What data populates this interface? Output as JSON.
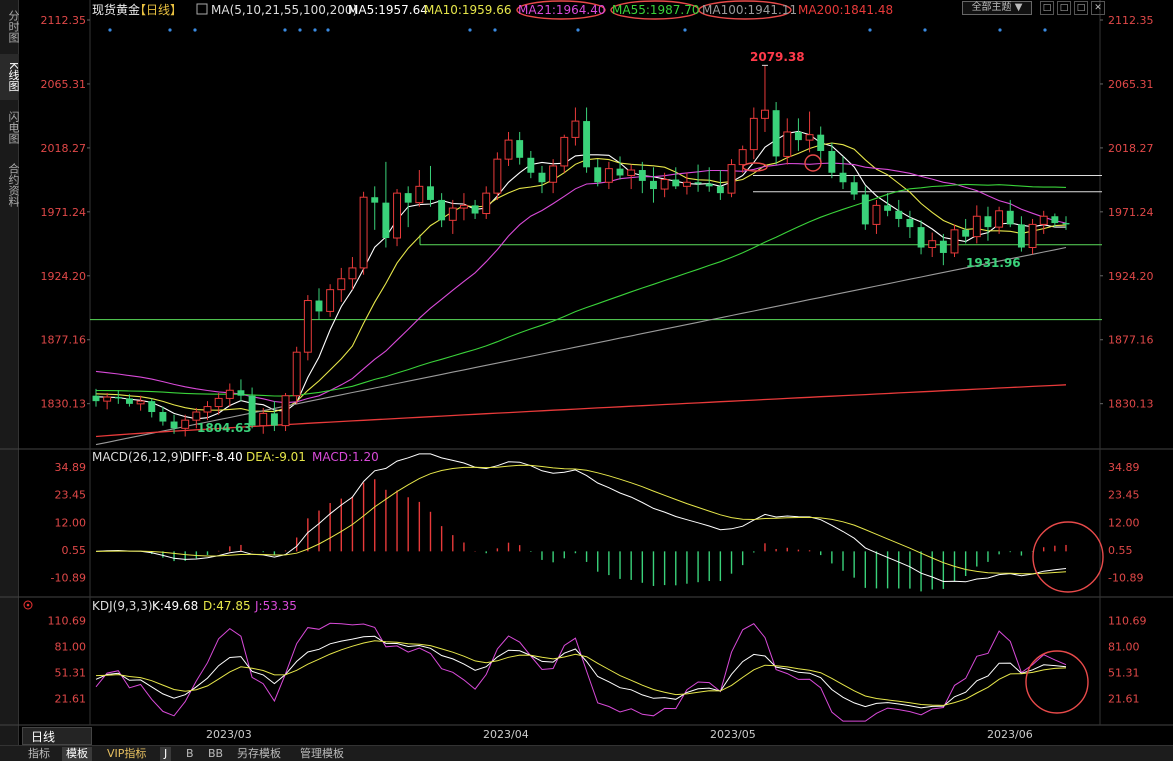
{
  "sidebar": {
    "tabs": [
      "分时图",
      "K线图",
      "闪电图",
      "合约资料"
    ],
    "active_index": 1
  },
  "header": {
    "instrument": "现货黄金",
    "period": "【日线】",
    "ma_label": "MA(5,10,21,55,100,200)",
    "ma_values": [
      {
        "text": "MA5:1957.64",
        "color": "#ffffff"
      },
      {
        "text": "MA10:1959.66",
        "color": "#e6e64a"
      },
      {
        "text": "MA21:1964.40",
        "color": "#d84ad8"
      },
      {
        "text": "MA55:1987.70",
        "color": "#3ad23a"
      },
      {
        "text": "MA100:1941.11",
        "color": "#9a9a9a"
      },
      {
        "text": "MA200:1841.48",
        "color": "#e83a3a"
      }
    ],
    "theme_button": "全部主题",
    "window_buttons": [
      "□",
      "□",
      "□",
      "✕"
    ]
  },
  "price_axis": {
    "ticks": [
      "2112.35",
      "2065.31",
      "2018.27",
      "1971.24",
      "1924.20",
      "1877.16",
      "1830.13"
    ],
    "range": [
      1799.0,
      2112.35
    ]
  },
  "annotations": {
    "high": "2079.38",
    "low": "1804.63",
    "mid_low": "1931.96"
  },
  "macd": {
    "label": "MACD(26,12,9)",
    "diff": "DIFF:-8.40",
    "dea": "DEA:-9.01",
    "macd": "MACD:1.20",
    "ticks": [
      "34.89",
      "23.45",
      "12.00",
      "0.55",
      "-10.89"
    ],
    "range": [
      -16,
      37
    ]
  },
  "kdj": {
    "label": "KDJ(9,3,3)",
    "k": "K:49.68",
    "d": "D:47.85",
    "j": "J:53.35",
    "ticks": [
      "110.69",
      "81.00",
      "51.31",
      "21.61"
    ],
    "range": [
      -5,
      118
    ]
  },
  "x_axis": {
    "labels": [
      "2023/03",
      "2023/04",
      "2023/05",
      "2023/06"
    ]
  },
  "period_tab": "日线",
  "bottom_tabs": [
    {
      "label": "指标",
      "active": false,
      "vip": false
    },
    {
      "label": "模板",
      "active": true,
      "vip": false
    },
    {
      "label": "VIP指标",
      "active": false,
      "vip": true
    },
    {
      "label": "J",
      "active": true,
      "vip": false
    },
    {
      "label": "B",
      "active": false,
      "vip": false
    },
    {
      "label": "BB",
      "active": false,
      "vip": false
    },
    {
      "label": "另存模板",
      "active": false,
      "vip": false
    },
    {
      "label": "管理模板",
      "active": false,
      "vip": false
    }
  ],
  "chart_data": {
    "type": "candlestick",
    "title": "现货黄金【日线】",
    "horizontal_levels": [
      1998,
      1986,
      1947,
      1892
    ],
    "candles_ohlc_approx": [
      [
        1836,
        1841,
        1828,
        1832
      ],
      [
        1832,
        1838,
        1826,
        1835
      ],
      [
        1835,
        1840,
        1830,
        1834
      ],
      [
        1834,
        1837,
        1828,
        1830
      ],
      [
        1830,
        1836,
        1825,
        1832
      ],
      [
        1832,
        1834,
        1820,
        1824
      ],
      [
        1824,
        1828,
        1814,
        1817
      ],
      [
        1817,
        1822,
        1808,
        1812
      ],
      [
        1812,
        1822,
        1806,
        1818
      ],
      [
        1818,
        1827,
        1812,
        1824
      ],
      [
        1824,
        1832,
        1818,
        1828
      ],
      [
        1828,
        1838,
        1822,
        1834
      ],
      [
        1834,
        1845,
        1828,
        1840
      ],
      [
        1840,
        1848,
        1832,
        1836
      ],
      [
        1836,
        1842,
        1812,
        1814
      ],
      [
        1814,
        1827,
        1808,
        1823
      ],
      [
        1823,
        1832,
        1810,
        1814
      ],
      [
        1814,
        1838,
        1810,
        1836
      ],
      [
        1836,
        1872,
        1830,
        1868
      ],
      [
        1868,
        1910,
        1862,
        1906
      ],
      [
        1906,
        1915,
        1892,
        1898
      ],
      [
        1898,
        1918,
        1894,
        1914
      ],
      [
        1914,
        1930,
        1905,
        1922
      ],
      [
        1922,
        1938,
        1914,
        1930
      ],
      [
        1930,
        1986,
        1925,
        1982
      ],
      [
        1982,
        1990,
        1958,
        1978
      ],
      [
        1978,
        2008,
        1945,
        1952
      ],
      [
        1952,
        1988,
        1946,
        1985
      ],
      [
        1985,
        1990,
        1960,
        1978
      ],
      [
        1978,
        2002,
        1975,
        1990
      ],
      [
        1990,
        2005,
        1975,
        1980
      ],
      [
        1980,
        1985,
        1960,
        1965
      ],
      [
        1965,
        1980,
        1955,
        1974
      ],
      [
        1974,
        1985,
        1965,
        1976
      ],
      [
        1976,
        1980,
        1966,
        1970
      ],
      [
        1970,
        1990,
        1966,
        1985
      ],
      [
        1985,
        2015,
        1980,
        2010
      ],
      [
        2010,
        2030,
        2005,
        2024
      ],
      [
        2024,
        2030,
        2006,
        2011
      ],
      [
        2011,
        2016,
        1996,
        2000
      ],
      [
        2000,
        2005,
        1985,
        1993
      ],
      [
        1993,
        2010,
        1985,
        2005
      ],
      [
        2005,
        2028,
        2000,
        2026
      ],
      [
        2026,
        2048,
        2020,
        2038
      ],
      [
        2038,
        2048,
        2000,
        2004
      ],
      [
        2004,
        2010,
        1990,
        1993
      ],
      [
        1993,
        2008,
        1988,
        2003
      ],
      [
        2003,
        2012,
        1995,
        1998
      ],
      [
        1998,
        2006,
        1988,
        2002
      ],
      [
        2002,
        2008,
        1985,
        1994
      ],
      [
        1994,
        2004,
        1978,
        1988
      ],
      [
        1988,
        2000,
        1982,
        1995
      ],
      [
        1995,
        2004,
        1988,
        1990
      ],
      [
        1990,
        2000,
        1984,
        1993
      ],
      [
        1993,
        2006,
        1986,
        1992
      ],
      [
        1992,
        2004,
        1986,
        1990
      ],
      [
        1990,
        2002,
        1980,
        1985
      ],
      [
        1985,
        2010,
        1982,
        2006
      ],
      [
        2006,
        2020,
        2000,
        2017
      ],
      [
        2017,
        2048,
        2010,
        2040
      ],
      [
        2040,
        2079,
        2030,
        2046
      ],
      [
        2046,
        2052,
        2006,
        2012
      ],
      [
        2012,
        2040,
        2006,
        2030
      ],
      [
        2030,
        2040,
        2016,
        2024
      ],
      [
        2024,
        2045,
        2015,
        2028
      ],
      [
        2028,
        2034,
        2008,
        2016
      ],
      [
        2016,
        2022,
        1996,
        2000
      ],
      [
        2000,
        2012,
        1988,
        1993
      ],
      [
        1993,
        1998,
        1980,
        1984
      ],
      [
        1984,
        1990,
        1958,
        1962
      ],
      [
        1962,
        1980,
        1955,
        1976
      ],
      [
        1976,
        1985,
        1968,
        1972
      ],
      [
        1972,
        1980,
        1960,
        1966
      ],
      [
        1966,
        1972,
        1952,
        1960
      ],
      [
        1960,
        1965,
        1940,
        1945
      ],
      [
        1945,
        1956,
        1938,
        1950
      ],
      [
        1950,
        1955,
        1932,
        1941
      ],
      [
        1941,
        1962,
        1938,
        1958
      ],
      [
        1958,
        1966,
        1948,
        1953
      ],
      [
        1953,
        1976,
        1948,
        1968
      ],
      [
        1968,
        1975,
        1950,
        1960
      ],
      [
        1960,
        1975,
        1955,
        1972
      ],
      [
        1972,
        1980,
        1960,
        1962
      ],
      [
        1962,
        1968,
        1942,
        1945
      ],
      [
        1945,
        1966,
        1940,
        1962
      ],
      [
        1962,
        1972,
        1955,
        1968
      ],
      [
        1968,
        1970,
        1960,
        1963
      ],
      [
        1963,
        1968,
        1958,
        1962
      ]
    ]
  }
}
